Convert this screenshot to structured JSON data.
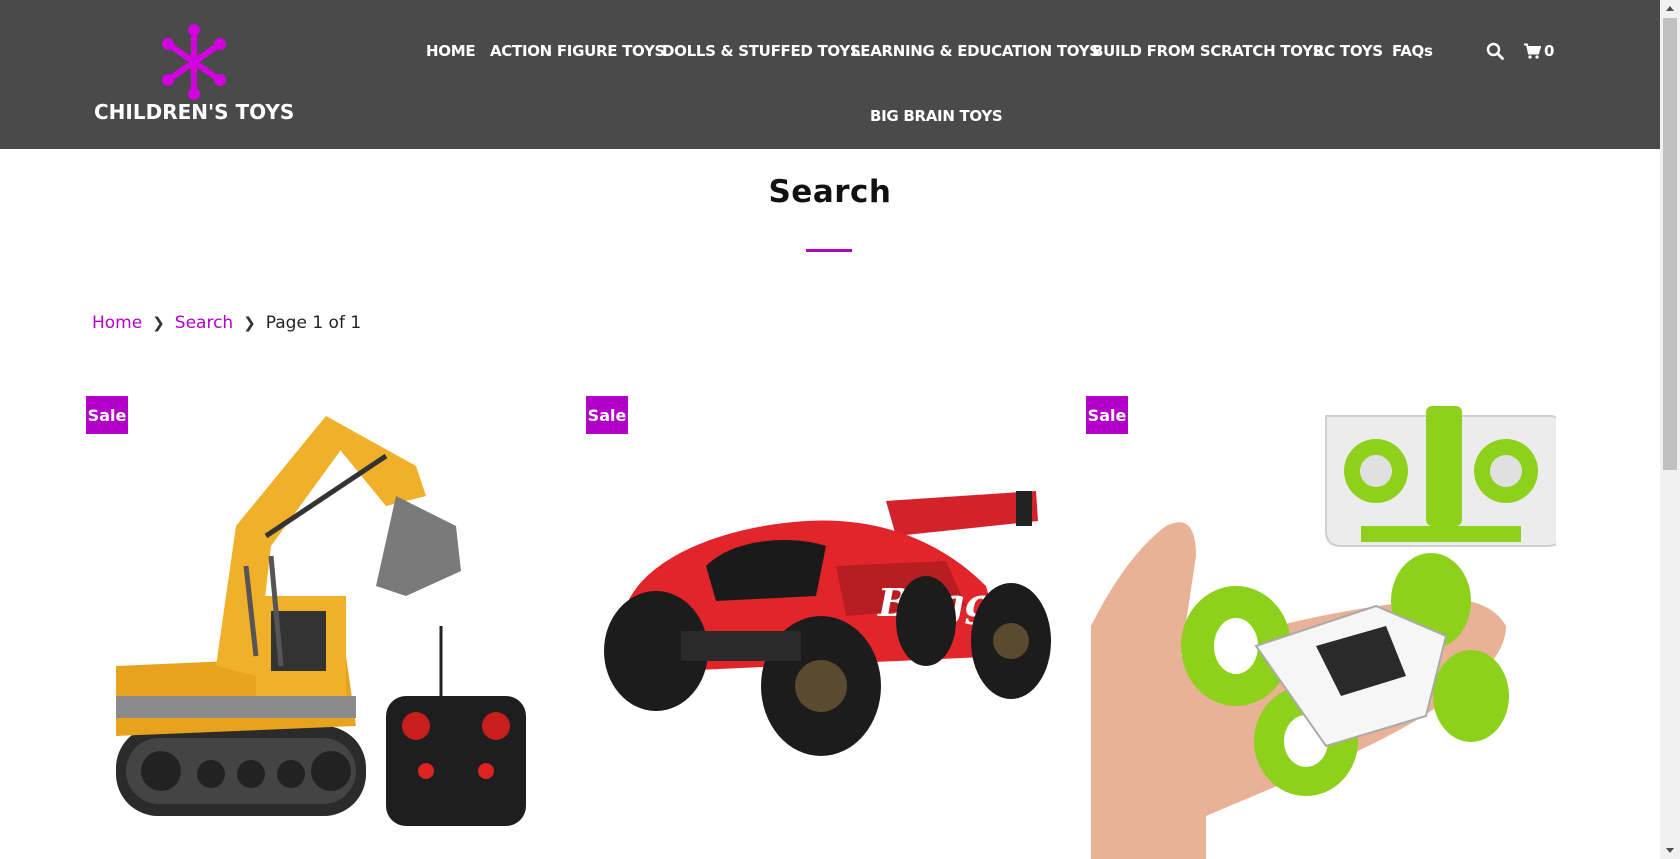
{
  "site": {
    "logo_text": "CHILDREN'S TOYS",
    "brand_color": "#b300c8",
    "header_bg": "#4a4a4a"
  },
  "nav": {
    "items": [
      {
        "label": "HOME"
      },
      {
        "label": "ACTION FIGURE TOYS"
      },
      {
        "label": "DOLLS & STUFFED TOYS"
      },
      {
        "label": "LEARNING & EDUCATION TOYS"
      },
      {
        "label": "BUILD FROM SCRATCH TOYS"
      },
      {
        "label": "RC TOYS"
      },
      {
        "label": "FAQs"
      },
      {
        "label": "BIG BRAIN TOYS"
      }
    ],
    "search_icon": "search-icon",
    "cart_icon": "cart-icon",
    "cart_count": "0"
  },
  "page": {
    "title": "Search"
  },
  "breadcrumb": {
    "home": "Home",
    "search": "Search",
    "current": "Page 1 of 1"
  },
  "products": [
    {
      "badge": "Sale",
      "image": "rc-excavator-with-remote"
    },
    {
      "badge": "Sale",
      "image": "red-rc-buggy"
    },
    {
      "badge": "Sale",
      "image": "green-rc-stunt-car-in-hand-with-remote"
    }
  ]
}
